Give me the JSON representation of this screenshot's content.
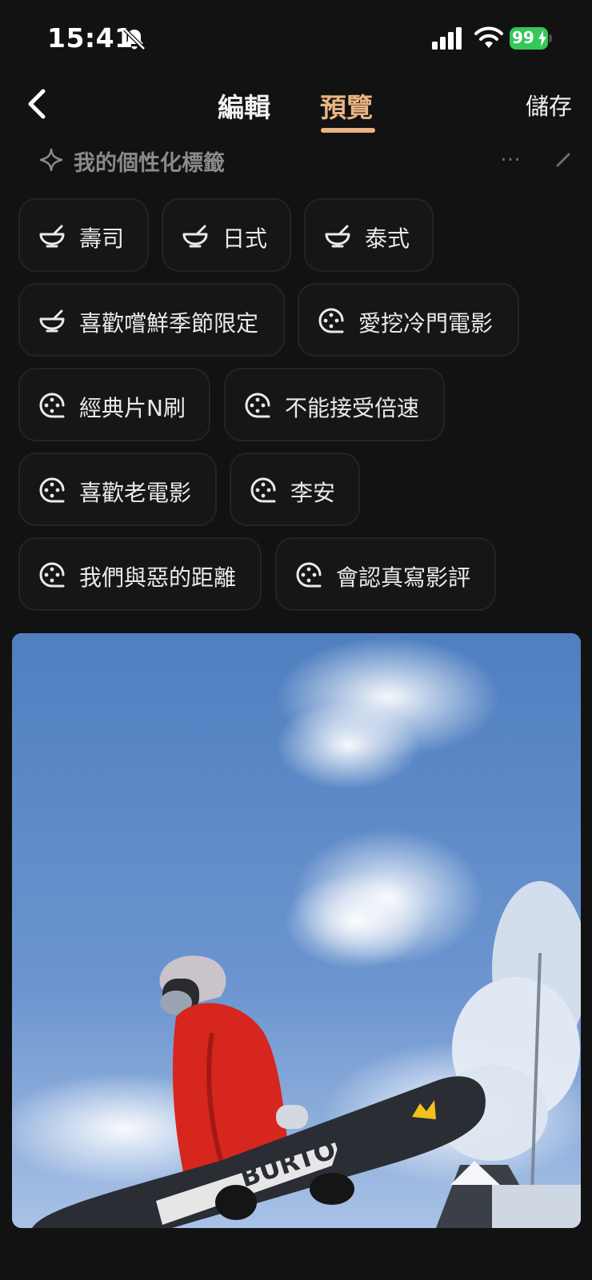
{
  "status_bar": {
    "time": "15:41",
    "battery_percent": "99",
    "icons": [
      "bell-slash-icon",
      "signal-icon",
      "wifi-icon",
      "battery-charging-icon"
    ]
  },
  "nav": {
    "back_icon": "chevron-left-icon",
    "tabs": [
      {
        "label": "編輯",
        "active": false
      },
      {
        "label": "預覽",
        "active": true
      }
    ],
    "save_label": "儲存",
    "accent_color": "#e9b582"
  },
  "section": {
    "icon": "sparkle-icon",
    "title": "我的個性化標籤",
    "more_label": "…"
  },
  "tags": [
    {
      "label": "壽司",
      "icon": "bowl-icon"
    },
    {
      "label": "日式",
      "icon": "bowl-icon"
    },
    {
      "label": "泰式",
      "icon": "bowl-icon"
    },
    {
      "label": "喜歡嚐鮮季節限定",
      "icon": "bowl-icon"
    },
    {
      "label": "愛挖冷門電影",
      "icon": "film-reel-icon"
    },
    {
      "label": "經典片N刷",
      "icon": "film-reel-icon"
    },
    {
      "label": "不能接受倍速",
      "icon": "film-reel-icon"
    },
    {
      "label": "喜歡老電影",
      "icon": "film-reel-icon"
    },
    {
      "label": "李安",
      "icon": "film-reel-icon"
    },
    {
      "label": "我們與惡的距離",
      "icon": "film-reel-icon"
    },
    {
      "label": "會認真寫影評",
      "icon": "film-reel-icon"
    }
  ],
  "photo": {
    "description_icon": "profile-photo",
    "board_text": "BURTON"
  }
}
